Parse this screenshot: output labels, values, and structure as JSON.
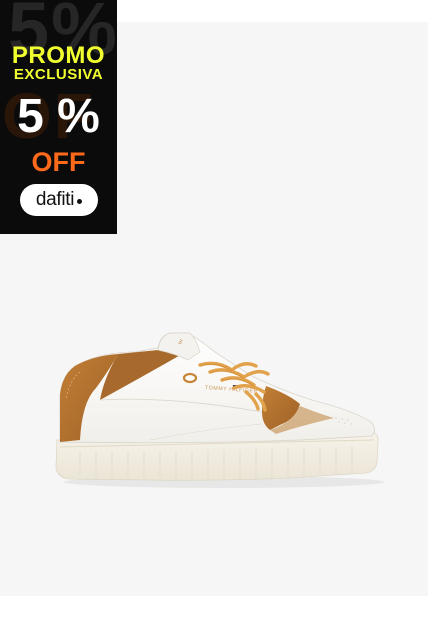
{
  "promo": {
    "line1": "PROMO",
    "line2": "EXCLUSIVA",
    "discount": "5 %",
    "off": "OFF",
    "brand": "dafiti",
    "colors": {
      "background": "#0b0b0b",
      "headline": "#f1ff2f",
      "discount": "#ffffff",
      "off": "#ff6a1a"
    }
  },
  "product": {
    "brand_print": "TOMMY HILFIGER",
    "image_icon": "sneaker-icon",
    "colors": {
      "upper": "#ffffff",
      "accent": "#b5722e",
      "laces": "#e2a24c",
      "sole": "#f3efe4",
      "background": "#f6f6f6"
    }
  }
}
